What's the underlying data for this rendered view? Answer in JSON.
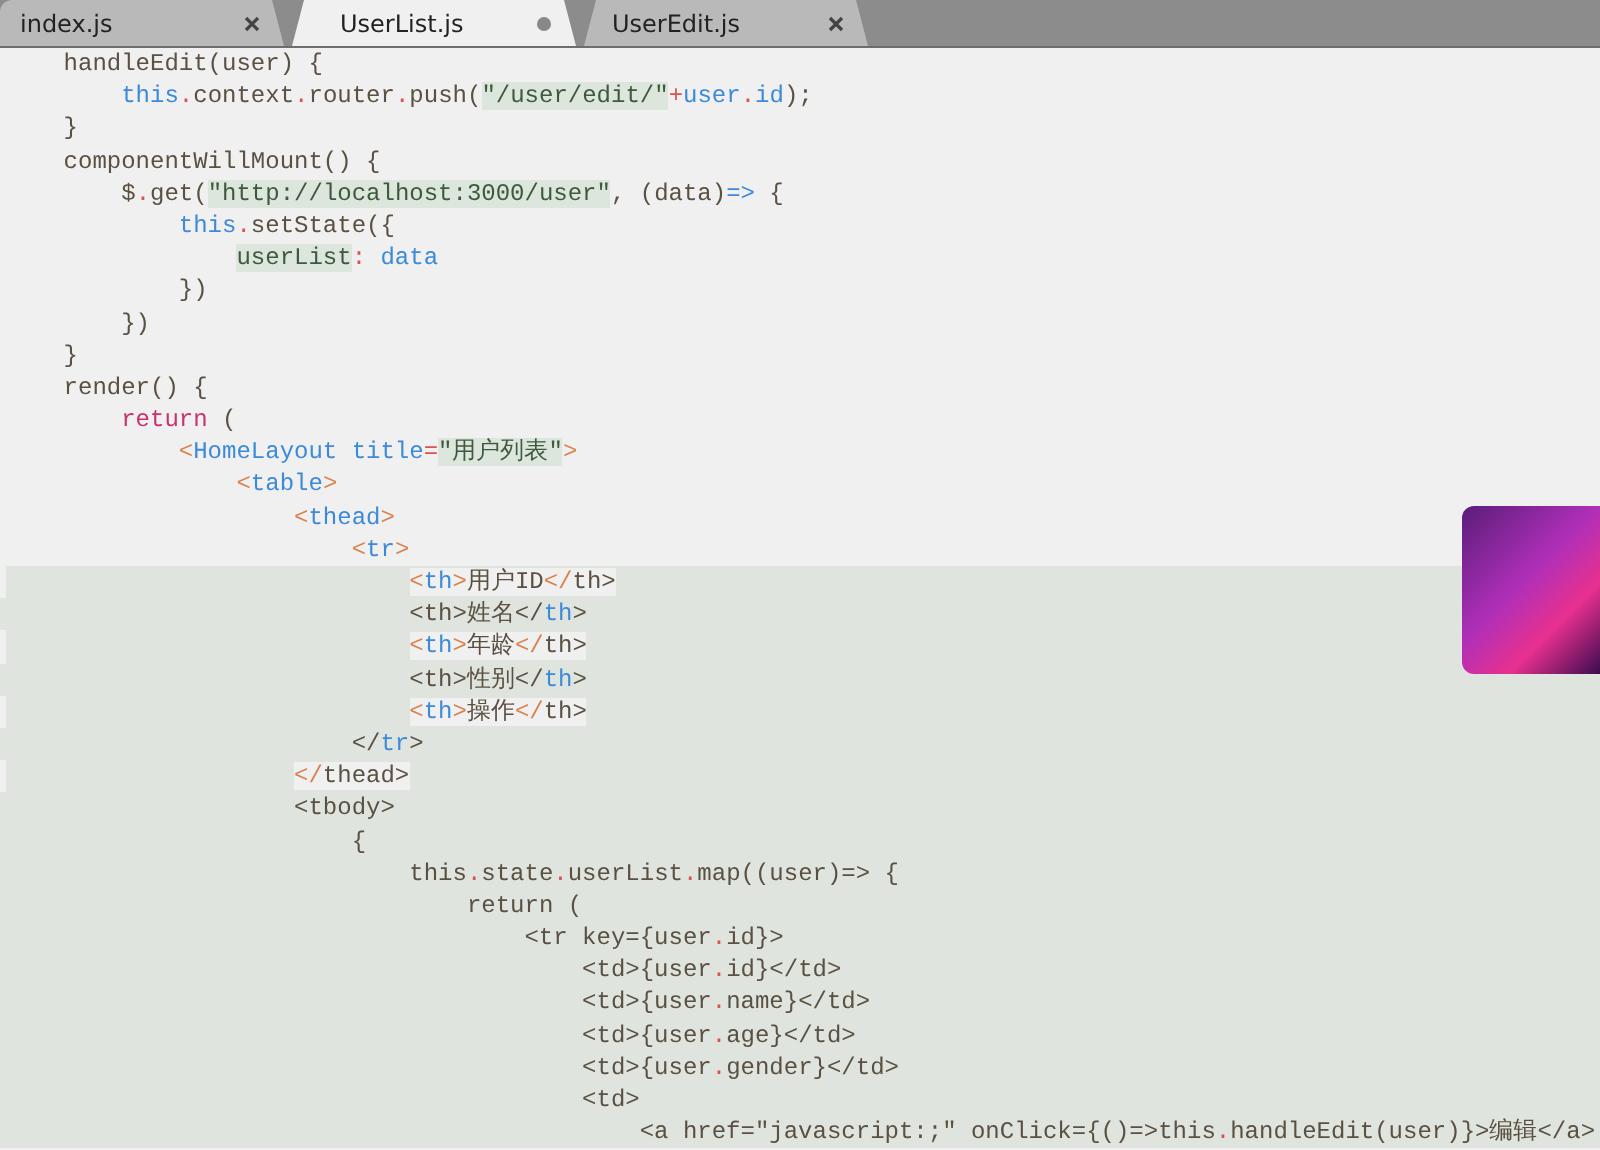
{
  "tabs": [
    {
      "label": "index.js",
      "selected": false,
      "modified": false
    },
    {
      "label": "UserList.js",
      "selected": true,
      "modified": true
    },
    {
      "label": "UserEdit.js",
      "selected": false,
      "modified": false
    }
  ],
  "lines": [
    {
      "kind": "plain",
      "tokens": [
        {
          "kind": "plain",
          "text": "handleEdit(user) {"
        }
      ],
      "children": [
        {
          "kind": "plain",
          "tokens": [
            {
              "kind": "keyword",
              "text": "this"
            },
            {
              "kind": "punct",
              "text": "."
            },
            {
              "kind": "plain",
              "text": "context"
            },
            {
              "kind": "punct",
              "text": "."
            },
            {
              "kind": "plain",
              "text": "router"
            },
            {
              "kind": "punct",
              "text": "."
            },
            {
              "kind": "plain",
              "text": "push("
            },
            {
              "kind": "string",
              "text": "\"/user/edit/\""
            },
            {
              "kind": "punct",
              "text": "+"
            },
            {
              "kind": "keyword",
              "text": "user"
            },
            {
              "kind": "punct",
              "text": "."
            },
            {
              "kind": "keyword",
              "text": "id"
            },
            {
              "kind": "plain",
              "text": ");"
            }
          ]
        }
      ]
    },
    {
      "kind": "plain",
      "tokens": [
        {
          "kind": "plain",
          "text": "}"
        }
      ]
    },
    {
      "kind": "plain",
      "tokens": [
        {
          "kind": "plain",
          "text": "componentWillMount() {"
        }
      ],
      "children": [
        {
          "kind": "plain",
          "tokens": [
            {
              "kind": "plain",
              "text": "$"
            },
            {
              "kind": "punct",
              "text": "."
            },
            {
              "kind": "plain",
              "text": "get("
            },
            {
              "kind": "string",
              "text": "\"http://localhost:3000/user\""
            },
            {
              "kind": "plain",
              "text": ", (data)"
            },
            {
              "kind": "keyword",
              "text": "=>"
            },
            {
              "kind": "plain",
              "text": " {"
            }
          ],
          "children": [
            {
              "kind": "plain",
              "tokens": [
                {
                  "kind": "keyword",
                  "text": "this"
                },
                {
                  "kind": "punct",
                  "text": "."
                },
                {
                  "kind": "plain",
                  "text": "setState({"
                }
              ],
              "children": [
                {
                  "kind": "plain",
                  "tokens": [
                    {
                      "kind": "string",
                      "text": "userList"
                    },
                    {
                      "kind": "punct",
                      "text": ":"
                    },
                    {
                      "kind": "keyword",
                      "text": " data"
                    }
                  ]
                }
              ]
            },
            {
              "kind": "plain",
              "tokens": [
                {
                  "kind": "plain",
                  "text": "})"
                }
              ]
            }
          ]
        },
        {
          "kind": "plain",
          "tokens": [
            {
              "kind": "plain",
              "text": "})"
            }
          ]
        }
      ]
    },
    {
      "kind": "plain",
      "tokens": [
        {
          "kind": "plain",
          "text": "}"
        }
      ]
    },
    {
      "kind": "plain",
      "tokens": [
        {
          "kind": "plain",
          "text": "render() {"
        }
      ],
      "children": [
        {
          "kind": "plain",
          "tokens": [
            {
              "kind": "control",
              "text": "return"
            },
            {
              "kind": "plain",
              "text": " ("
            }
          ],
          "children": [
            {
              "kind": "plain",
              "tokens": [
                {
                  "kind": "bracket",
                  "text": "<"
                },
                {
                  "kind": "keyword",
                  "text": "HomeLayout"
                },
                {
                  "kind": "keyword",
                  "text": " title"
                },
                {
                  "kind": "punct",
                  "text": "="
                },
                {
                  "kind": "string",
                  "text": "\"用户列表\""
                },
                {
                  "kind": "bracket",
                  "text": ">"
                }
              ],
              "children": [
                {
                  "kind": "plain",
                  "tokens": [
                    {
                      "kind": "bracket",
                      "text": "<"
                    },
                    {
                      "kind": "keyword",
                      "text": "table"
                    },
                    {
                      "kind": "bracket",
                      "text": ">"
                    }
                  ],
                  "children": [
                    {
                      "kind": "plain",
                      "tokens": [
                        {
                          "kind": "bracket",
                          "text": "<"
                        },
                        {
                          "kind": "keyword",
                          "text": "thead"
                        },
                        {
                          "kind": "bracket",
                          "text": ">"
                        }
                      ],
                      "children": [
                        {
                          "kind": "plain",
                          "tokens": [
                            {
                              "kind": "bracket",
                              "text": "<"
                            },
                            {
                              "kind": "keyword",
                              "text": "tr"
                            },
                            {
                              "kind": "bracket",
                              "text": ">"
                            }
                          ],
                          "children": [
                            {
                              "kind": "trailing-highlight",
                              "tokens": [
                                {
                                  "kind": "bracket",
                                  "text": "<"
                                },
                                {
                                  "kind": "keyword",
                                  "text": "th"
                                },
                                {
                                  "kind": "bracket",
                                  "text": ">"
                                },
                                {
                                  "kind": "plain",
                                  "text": "用户ID"
                                },
                                {
                                  "kind": "bracket",
                                  "text": "</"
                                },
                                {
                                  "kind": "plain",
                                  "text": "th>"
                                }
                              ]
                            },
                            {
                              "kind": "highlighted",
                              "tokens": [
                                {
                                  "kind": "plain",
                                  "text": "<th>姓名</"
                                },
                                {
                                  "kind": "keyword",
                                  "text": "th"
                                },
                                {
                                  "kind": "plain",
                                  "text": ">"
                                }
                              ]
                            },
                            {
                              "kind": "trailing-highlight",
                              "tokens": [
                                {
                                  "kind": "bracket",
                                  "text": "<"
                                },
                                {
                                  "kind": "keyword",
                                  "text": "th"
                                },
                                {
                                  "kind": "bracket",
                                  "text": ">"
                                },
                                {
                                  "kind": "plain",
                                  "text": "年龄"
                                },
                                {
                                  "kind": "bracket",
                                  "text": "</"
                                },
                                {
                                  "kind": "plain",
                                  "text": "th>"
                                }
                              ]
                            },
                            {
                              "kind": "highlighted",
                              "tokens": [
                                {
                                  "kind": "plain",
                                  "text": "<th>性别</"
                                },
                                {
                                  "kind": "keyword",
                                  "text": "th"
                                },
                                {
                                  "kind": "plain",
                                  "text": ">"
                                }
                              ]
                            },
                            {
                              "kind": "trailing-highlight",
                              "tokens": [
                                {
                                  "kind": "bracket",
                                  "text": "<"
                                },
                                {
                                  "kind": "keyword",
                                  "text": "th"
                                },
                                {
                                  "kind": "bracket",
                                  "text": ">"
                                },
                                {
                                  "kind": "plain",
                                  "text": "操作"
                                },
                                {
                                  "kind": "bracket",
                                  "text": "</"
                                },
                                {
                                  "kind": "plain",
                                  "text": "th>"
                                }
                              ]
                            }
                          ]
                        },
                        {
                          "kind": "highlighted",
                          "tokens": [
                            {
                              "kind": "plain",
                              "text": "</"
                            },
                            {
                              "kind": "keyword",
                              "text": "tr"
                            },
                            {
                              "kind": "plain",
                              "text": ">"
                            }
                          ]
                        }
                      ]
                    },
                    {
                      "kind": "trailing-highlight",
                      "tokens": [
                        {
                          "kind": "bracket",
                          "text": "</"
                        },
                        {
                          "kind": "plain",
                          "text": "thead>"
                        }
                      ]
                    },
                    {
                      "kind": "highlighted",
                      "tokens": [
                        {
                          "kind": "plain",
                          "text": "<tbody>"
                        }
                      ],
                      "children": [
                        {
                          "kind": "highlighted",
                          "tokens": [
                            {
                              "kind": "plain",
                              "text": "{"
                            }
                          ],
                          "children": [
                            {
                              "kind": "highlighted",
                              "tokens": [
                                {
                                  "kind": "plain",
                                  "text": "this"
                                },
                                {
                                  "kind": "punct",
                                  "text": "."
                                },
                                {
                                  "kind": "plain",
                                  "text": "state"
                                },
                                {
                                  "kind": "punct",
                                  "text": "."
                                },
                                {
                                  "kind": "plain",
                                  "text": "userList"
                                },
                                {
                                  "kind": "punct",
                                  "text": "."
                                },
                                {
                                  "kind": "plain",
                                  "text": "map((user)=> {"
                                }
                              ],
                              "children": [
                                {
                                  "kind": "highlighted",
                                  "tokens": [
                                    {
                                      "kind": "plain",
                                      "text": "return ("
                                    }
                                  ],
                                  "children": [
                                    {
                                      "kind": "highlighted",
                                      "tokens": [
                                        {
                                          "kind": "plain",
                                          "text": "<tr key={user"
                                        },
                                        {
                                          "kind": "punct",
                                          "text": "."
                                        },
                                        {
                                          "kind": "plain",
                                          "text": "id}>"
                                        }
                                      ],
                                      "children": [
                                        {
                                          "kind": "highlighted",
                                          "tokens": [
                                            {
                                              "kind": "plain",
                                              "text": "<td>{user"
                                            },
                                            {
                                              "kind": "punct",
                                              "text": "."
                                            },
                                            {
                                              "kind": "plain",
                                              "text": "id}</td>"
                                            }
                                          ]
                                        },
                                        {
                                          "kind": "highlighted",
                                          "tokens": [
                                            {
                                              "kind": "plain",
                                              "text": "<td>{user"
                                            },
                                            {
                                              "kind": "punct",
                                              "text": "."
                                            },
                                            {
                                              "kind": "plain",
                                              "text": "name}</td>"
                                            }
                                          ]
                                        },
                                        {
                                          "kind": "highlighted",
                                          "tokens": [
                                            {
                                              "kind": "plain",
                                              "text": "<td>{user"
                                            },
                                            {
                                              "kind": "punct",
                                              "text": "."
                                            },
                                            {
                                              "kind": "plain",
                                              "text": "age}</td>"
                                            }
                                          ]
                                        },
                                        {
                                          "kind": "highlighted",
                                          "tokens": [
                                            {
                                              "kind": "plain",
                                              "text": "<td>{user"
                                            },
                                            {
                                              "kind": "punct",
                                              "text": "."
                                            },
                                            {
                                              "kind": "plain",
                                              "text": "gender}</td>"
                                            }
                                          ]
                                        },
                                        {
                                          "kind": "highlighted",
                                          "tokens": [
                                            {
                                              "kind": "plain",
                                              "text": "<td>"
                                            }
                                          ],
                                          "children": [
                                            {
                                              "kind": "highlighted",
                                              "tokens": [
                                                {
                                                  "kind": "plain",
                                                  "text": "<a href=\"javascript:;\" onClick={()=>this"
                                                },
                                                {
                                                  "kind": "punct",
                                                  "text": "."
                                                },
                                                {
                                                  "kind": "plain",
                                                  "text": "handleEdit(user)}>编辑</a>"
                                                }
                                              ]
                                            }
                                          ]
                                        }
                                      ]
                                    }
                                  ]
                                }
                              ]
                            }
                          ]
                        }
                      ]
                    }
                  ]
                }
              ]
            }
          ]
        }
      ]
    }
  ]
}
